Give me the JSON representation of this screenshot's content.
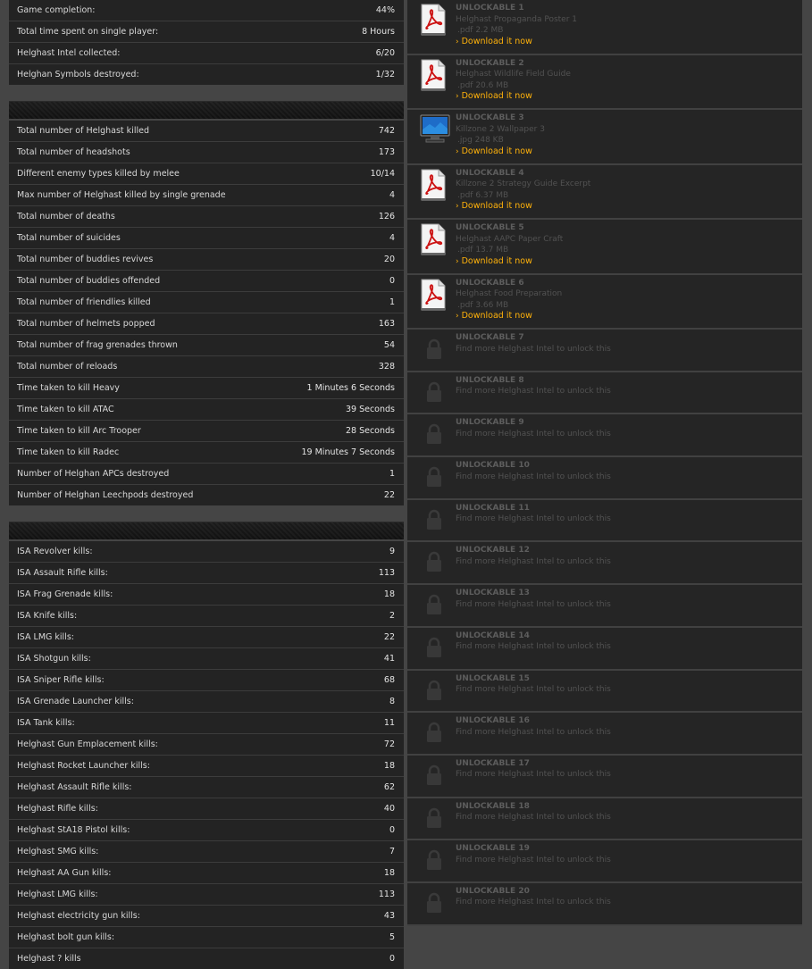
{
  "summary": [
    {
      "label": "Game completion:",
      "value": "44%"
    },
    {
      "label": "Total time spent on single player:",
      "value": "8 Hours"
    },
    {
      "label": "Helghast Intel collected:",
      "value": "6/20"
    },
    {
      "label": "Helghan Symbols destroyed:",
      "value": "1/32"
    }
  ],
  "combat": [
    {
      "label": "Total number of Helghast killed",
      "value": "742"
    },
    {
      "label": "Total number of headshots",
      "value": "173"
    },
    {
      "label": "Different enemy types killed by melee",
      "value": "10/14"
    },
    {
      "label": "Max number of Helghast killed by single grenade",
      "value": "4"
    },
    {
      "label": "Total number of deaths",
      "value": "126"
    },
    {
      "label": "Total number of suicides",
      "value": "4"
    },
    {
      "label": "Total number of buddies revives",
      "value": "20"
    },
    {
      "label": "Total number of buddies offended",
      "value": "0"
    },
    {
      "label": "Total number of friendlies killed",
      "value": "1"
    },
    {
      "label": "Total number of helmets popped",
      "value": "163"
    },
    {
      "label": "Total number of frag grenades thrown",
      "value": "54"
    },
    {
      "label": "Total number of reloads",
      "value": "328"
    },
    {
      "label": "Time taken to kill Heavy",
      "value": "1 Minutes 6 Seconds"
    },
    {
      "label": "Time taken to kill ATAC",
      "value": "39 Seconds"
    },
    {
      "label": "Time taken to kill Arc Trooper",
      "value": "28 Seconds"
    },
    {
      "label": "Time taken to kill Radec",
      "value": "19 Minutes 7 Seconds"
    },
    {
      "label": "Number of Helghan APCs destroyed",
      "value": "1"
    },
    {
      "label": "Number of Helghan Leechpods destroyed",
      "value": "22"
    }
  ],
  "weapons": [
    {
      "label": "ISA Revolver kills:",
      "value": "9"
    },
    {
      "label": "ISA Assault Rifle kills:",
      "value": "113"
    },
    {
      "label": "ISA Frag Grenade kills:",
      "value": "18"
    },
    {
      "label": "ISA Knife kills:",
      "value": "2"
    },
    {
      "label": "ISA LMG kills:",
      "value": "22"
    },
    {
      "label": "ISA Shotgun kills:",
      "value": "41"
    },
    {
      "label": "ISA Sniper Rifle kills:",
      "value": "68"
    },
    {
      "label": "ISA Grenade Launcher kills:",
      "value": "8"
    },
    {
      "label": "ISA Tank kills:",
      "value": "11"
    },
    {
      "label": "Helghast Gun Emplacement kills:",
      "value": "72"
    },
    {
      "label": "Helghast Rocket Launcher kills:",
      "value": "18"
    },
    {
      "label": "Helghast Assault Rifle kills:",
      "value": "62"
    },
    {
      "label": "Helghast Rifle kills:",
      "value": "40"
    },
    {
      "label": "Helghast StA18 Pistol kills:",
      "value": "0"
    },
    {
      "label": "Helghast SMG kills:",
      "value": "7"
    },
    {
      "label": "Helghast AA Gun kills:",
      "value": "18"
    },
    {
      "label": "Helghast LMG kills:",
      "value": "113"
    },
    {
      "label": "Helghast electricity gun kills:",
      "value": "43"
    },
    {
      "label": "Helghast bolt gun kills:",
      "value": "5"
    },
    {
      "label": "Helghast ? kills",
      "value": "0"
    }
  ],
  "unlockables": [
    {
      "title": "UNLOCKABLE 1",
      "name": "Helghast Propaganda Poster 1",
      "meta": ".pdf 2.2 MB",
      "link": "Download it now",
      "icon": "pdf-file-icon",
      "unlocked": true
    },
    {
      "title": "UNLOCKABLE 2",
      "name": "Helghast Wildlife Field Guide",
      "meta": ".pdf 20.6 MB",
      "link": "Download it now",
      "icon": "pdf-file-icon",
      "unlocked": true
    },
    {
      "title": "UNLOCKABLE 3",
      "name": "Killzone 2 Wallpaper 3",
      "meta": ".jpg 248 KB",
      "link": "Download it now",
      "icon": "monitor-wallpaper-icon",
      "unlocked": true
    },
    {
      "title": "UNLOCKABLE 4",
      "name": "Killzone 2 Strategy Guide Excerpt",
      "meta": ".pdf 6.37 MB",
      "link": "Download it now",
      "icon": "pdf-file-icon",
      "unlocked": true
    },
    {
      "title": "UNLOCKABLE 5",
      "name": "Helghast AAPC Paper Craft",
      "meta": ".pdf 13.7 MB",
      "link": "Download it now",
      "icon": "pdf-file-icon",
      "unlocked": true
    },
    {
      "title": "UNLOCKABLE 6",
      "name": "Helghast Food Preparation",
      "meta": ".pdf 3.66 MB",
      "link": "Download it now",
      "icon": "pdf-file-icon",
      "unlocked": true
    },
    {
      "title": "UNLOCKABLE 7",
      "name": "Find more Helghast Intel to unlock this",
      "unlocked": false,
      "icon": "lock-icon"
    },
    {
      "title": "UNLOCKABLE 8",
      "name": "Find more Helghast Intel to unlock this",
      "unlocked": false,
      "icon": "lock-icon"
    },
    {
      "title": "UNLOCKABLE 9",
      "name": "Find more Helghast Intel to unlock this",
      "unlocked": false,
      "icon": "lock-icon"
    },
    {
      "title": "UNLOCKABLE 10",
      "name": "Find more Helghast Intel to unlock this",
      "unlocked": false,
      "icon": "lock-icon"
    },
    {
      "title": "UNLOCKABLE 11",
      "name": "Find more Helghast Intel to unlock this",
      "unlocked": false,
      "icon": "lock-icon"
    },
    {
      "title": "UNLOCKABLE 12",
      "name": "Find more Helghast Intel to unlock this",
      "unlocked": false,
      "icon": "lock-icon"
    },
    {
      "title": "UNLOCKABLE 13",
      "name": "Find more Helghast Intel to unlock this",
      "unlocked": false,
      "icon": "lock-icon"
    },
    {
      "title": "UNLOCKABLE 14",
      "name": "Find more Helghast Intel to unlock this",
      "unlocked": false,
      "icon": "lock-icon"
    },
    {
      "title": "UNLOCKABLE 15",
      "name": "Find more Helghast Intel to unlock this",
      "unlocked": false,
      "icon": "lock-icon"
    },
    {
      "title": "UNLOCKABLE 16",
      "name": "Find more Helghast Intel to unlock this",
      "unlocked": false,
      "icon": "lock-icon"
    },
    {
      "title": "UNLOCKABLE 17",
      "name": "Find more Helghast Intel to unlock this",
      "unlocked": false,
      "icon": "lock-icon"
    },
    {
      "title": "UNLOCKABLE 18",
      "name": "Find more Helghast Intel to unlock this",
      "unlocked": false,
      "icon": "lock-icon"
    },
    {
      "title": "UNLOCKABLE 19",
      "name": "Find more Helghast Intel to unlock this",
      "unlocked": false,
      "icon": "lock-icon"
    },
    {
      "title": "UNLOCKABLE 20",
      "name": "Find more Helghast Intel to unlock this",
      "unlocked": false,
      "icon": "lock-icon"
    }
  ],
  "colors": {
    "background": "#454545",
    "panel": "#232323",
    "link": "#ffb20b",
    "pdf_red": "#cc1111"
  }
}
